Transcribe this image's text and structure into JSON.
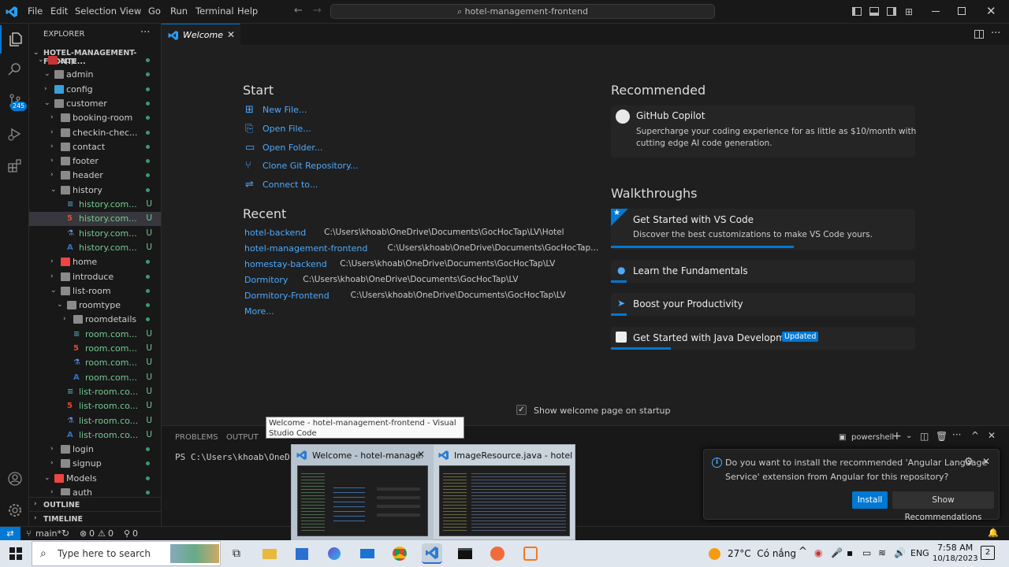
{
  "titlebar": {
    "menus": [
      "File",
      "Edit",
      "Selection",
      "View",
      "Go",
      "Run",
      "Terminal",
      "Help"
    ],
    "command_center": "hotel-management-frontend"
  },
  "activity": {
    "source_control_badge": "245"
  },
  "explorer": {
    "header": "EXPLORER",
    "root": "HOTEL-MANAGEMENT-FRONTE...",
    "items": [
      {
        "label": "app",
        "depth": 1,
        "type": "folder",
        "open": true
      },
      {
        "label": "admin",
        "depth": 2,
        "type": "folder",
        "open": true
      },
      {
        "label": "config",
        "depth": 2,
        "type": "folder",
        "open": false
      },
      {
        "label": "customer",
        "depth": 2,
        "type": "folder",
        "open": true
      },
      {
        "label": "booking-room",
        "depth": 3,
        "type": "folder",
        "open": false
      },
      {
        "label": "checkin-chec...",
        "depth": 3,
        "type": "folder",
        "open": false
      },
      {
        "label": "contact",
        "depth": 3,
        "type": "folder",
        "open": false
      },
      {
        "label": "footer",
        "depth": 3,
        "type": "folder",
        "open": false
      },
      {
        "label": "header",
        "depth": 3,
        "type": "folder",
        "open": false
      },
      {
        "label": "history",
        "depth": 3,
        "type": "folder",
        "open": true
      },
      {
        "label": "history.com...",
        "depth": 4,
        "type": "css",
        "badge": "U"
      },
      {
        "label": "history.com...",
        "depth": 4,
        "type": "html",
        "badge": "U",
        "selected": true
      },
      {
        "label": "history.com...",
        "depth": 4,
        "type": "test",
        "badge": "U"
      },
      {
        "label": "history.com...",
        "depth": 4,
        "type": "ts",
        "badge": "U"
      },
      {
        "label": "home",
        "depth": 3,
        "type": "folder",
        "open": false
      },
      {
        "label": "introduce",
        "depth": 3,
        "type": "folder",
        "open": false
      },
      {
        "label": "list-room",
        "depth": 3,
        "type": "folder",
        "open": true
      },
      {
        "label": "roomtype",
        "depth": 4,
        "type": "folder",
        "open": true
      },
      {
        "label": "roomdetails",
        "depth": 5,
        "type": "folder",
        "open": false
      },
      {
        "label": "room.com...",
        "depth": 5,
        "type": "css",
        "badge": "U"
      },
      {
        "label": "room.com...",
        "depth": 5,
        "type": "html",
        "badge": "U"
      },
      {
        "label": "room.com...",
        "depth": 5,
        "type": "test",
        "badge": "U"
      },
      {
        "label": "room.com...",
        "depth": 5,
        "type": "ts",
        "badge": "U"
      },
      {
        "label": "list-room.co...",
        "depth": 4,
        "type": "css",
        "badge": "U"
      },
      {
        "label": "list-room.co...",
        "depth": 4,
        "type": "html",
        "badge": "U"
      },
      {
        "label": "list-room.co...",
        "depth": 4,
        "type": "test",
        "badge": "U"
      },
      {
        "label": "list-room.co...",
        "depth": 4,
        "type": "ts",
        "badge": "U"
      },
      {
        "label": "login",
        "depth": 3,
        "type": "folder",
        "open": false
      },
      {
        "label": "signup",
        "depth": 3,
        "type": "folder",
        "open": false
      },
      {
        "label": "Models",
        "depth": 2,
        "type": "folder",
        "open": true
      },
      {
        "label": "auth",
        "depth": 3,
        "type": "folder",
        "open": false
      }
    ],
    "outline": "OUTLINE",
    "timeline": "TIMELINE"
  },
  "tab": {
    "label": "Welcome"
  },
  "welcome": {
    "start_heading": "Start",
    "start_items": [
      "New File...",
      "Open File...",
      "Open Folder...",
      "Clone Git Repository...",
      "Connect to..."
    ],
    "recent_heading": "Recent",
    "recent": [
      {
        "name": "hotel-backend",
        "path": "C:\\Users\\khoab\\OneDrive\\Documents\\GocHocTap\\LV\\Hotel"
      },
      {
        "name": "hotel-management-frontend",
        "path": "C:\\Users\\khoab\\OneDrive\\Documents\\GocHocTap..."
      },
      {
        "name": "homestay-backend",
        "path": "C:\\Users\\khoab\\OneDrive\\Documents\\GocHocTap\\LV"
      },
      {
        "name": "Dormitory",
        "path": "C:\\Users\\khoab\\OneDrive\\Documents\\GocHocTap\\LV"
      },
      {
        "name": "Dormitory-Frontend",
        "path": "C:\\Users\\khoab\\OneDrive\\Documents\\GocHocTap\\LV"
      }
    ],
    "more": "More...",
    "recommended_heading": "Recommended",
    "copilot_title": "GitHub Copilot",
    "copilot_desc1": "Supercharge your coding experience for as little as $10/month with",
    "copilot_desc2": "cutting edge AI code generation.",
    "walkthroughs_heading": "Walkthroughs",
    "walk1_title": "Get Started with VS Code",
    "walk1_desc": "Discover the best customizations to make VS Code yours.",
    "walk1_progress": 0.6,
    "walk2_title": "Learn the Fundamentals",
    "walk3_title": "Boost your Productivity",
    "walk4_title": "Get Started with Java Development",
    "walk4_badge": "Updated",
    "show_on_startup": "Show welcome page on startup"
  },
  "panel": {
    "tabs": [
      "PROBLEMS",
      "OUTPUT"
    ],
    "terminal_line": "PS C:\\Users\\khoab\\OneDriv",
    "shell": "powershell"
  },
  "tooltip": "Welcome - hotel-management-frontend - Visual Studio Code",
  "thumbnails": [
    {
      "title": "Welcome - hotel-manage..."
    },
    {
      "title": "ImageResource.java - hotel-bac..."
    }
  ],
  "notification": {
    "message1": "Do you want to install the recommended 'Angular Language",
    "message2": "Service' extension from Angular for this repository?",
    "install": "Install",
    "show": "Show Recommendations"
  },
  "statusbar": {
    "branch": "main*",
    "errors": "0",
    "warnings": "0",
    "ports": "0"
  },
  "taskbar": {
    "search_placeholder": "Type here to search",
    "weather": "27°C  Có nắng",
    "lang": "ENG",
    "time": "7:58 AM",
    "date": "10/18/2023",
    "notif_count": "2"
  },
  "colors": {
    "accent": "#0078d4",
    "link": "#4daafc",
    "git_untracked": "#73c991"
  }
}
